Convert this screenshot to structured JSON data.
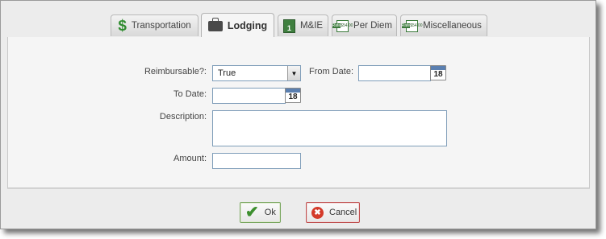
{
  "tabs": [
    {
      "label": "Transportation",
      "icon": "dollar-icon",
      "active": false
    },
    {
      "label": "Lodging",
      "icon": "briefcase-icon",
      "active": true
    },
    {
      "label": "M&IE",
      "icon": "meal-calendar-icon",
      "active": false
    },
    {
      "label": "Per Diem",
      "icon": "rate-card-icon",
      "active": false
    },
    {
      "label": "Miscellaneous",
      "icon": "rate-card-icon",
      "active": false
    }
  ],
  "tab_icon_text": {
    "me_digit": "1",
    "rate_top": "Rate",
    "rate_value": "$54.00"
  },
  "form": {
    "reimbursable_label": "Reimbursable?:",
    "reimbursable_value": "True",
    "from_date_label": "From Date:",
    "from_date_value": "",
    "to_date_label": "To Date:",
    "to_date_value": "",
    "description_label": "Description:",
    "description_value": "",
    "amount_label": "Amount:",
    "amount_value": "",
    "calendar_day": "18"
  },
  "buttons": {
    "ok_label": "Ok",
    "cancel_label": "Cancel"
  },
  "colors": {
    "ok_accent": "#3d8f2f",
    "cancel_accent": "#d43a2a",
    "field_border": "#7f9db9"
  }
}
